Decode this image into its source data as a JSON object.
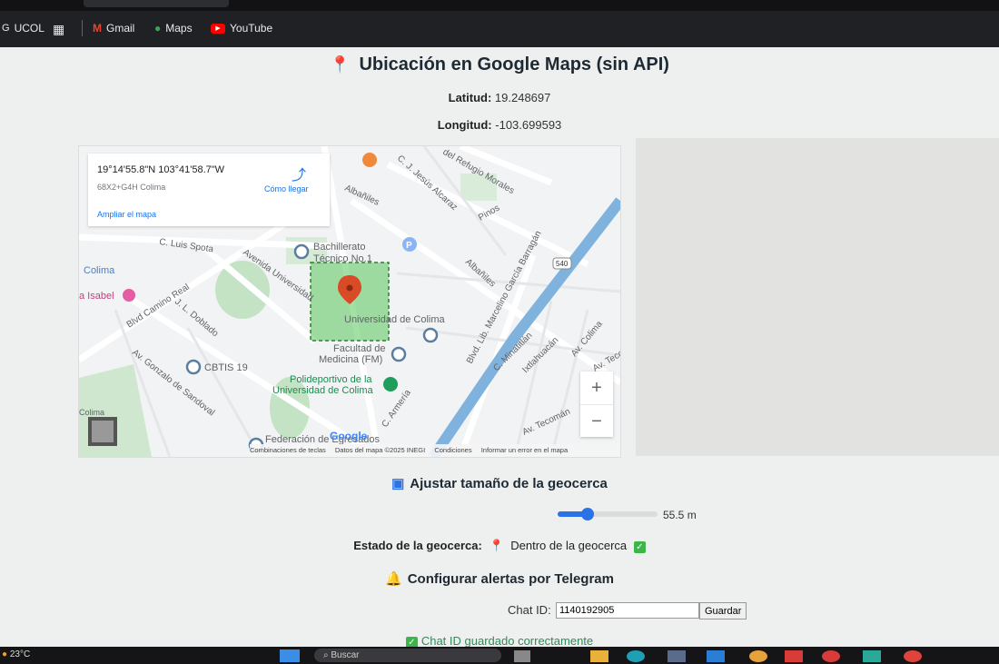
{
  "bookmarks": {
    "items": [
      {
        "label": "UCOL"
      },
      {
        "label": "Gmail"
      },
      {
        "label": "Maps"
      },
      {
        "label": "YouTube"
      }
    ]
  },
  "page": {
    "title": "Ubicación en Google Maps (sin API)",
    "lat_label": "Latitud:",
    "lat_value": "19.248697",
    "lng_label": "Longitud:",
    "lng_value": "-103.699593"
  },
  "map": {
    "card_coords": "19°14'55.8\"N 103°41'58.7\"W",
    "card_pluscode": "68X2+G4H Colima",
    "card_directions": "Cómo llegar",
    "card_enlarge": "Ampliar el mapa",
    "labels": {
      "refugio": "del Refugio Morales",
      "jesus": "C. J. Jesús Alcaraz",
      "albaniles": "Albañiles",
      "albaniles2": "Albañiles",
      "pinos": "Pinos",
      "luis": "C. Luis Spota",
      "colima": "Colima",
      "isabel": "a Isabel",
      "bachillerato1": "Bachillerato",
      "bachillerato2": "Técnico No.1",
      "avenida": "Avenida Universidad",
      "camino": "Blvd Camino Real",
      "doblado": "J. L. Doblado",
      "gonzalo": "Av. Gonzalo de Sandoval",
      "cbtis": "CBTIS 19",
      "universidad": "Universidad de Colima",
      "facultad1": "Facultad de",
      "facultad2": "Medicina (FM)",
      "poli1": "Polideportivo de la",
      "poli2": "Universidad de Colima",
      "marcelino": "Blvd. Lib. Marcelino García Barragán",
      "hwy": "540",
      "minatitlan": "C. Minatitlán",
      "ixtlahuacan": "Ixtlahuacán",
      "avcolima": "Av. Colima",
      "tecoman": "Av. Tecomán",
      "tecom2": "Av. Tecom",
      "armeria": "C. Armería",
      "federacion": "Federación de Egresados",
      "colima_small": "Colima",
      "parking": "P"
    },
    "zoom_in": "+",
    "zoom_out": "−",
    "google": "Google",
    "footer": {
      "keys": "Combinaciones de teclas",
      "data": "Datos del mapa ©2025 INEGI",
      "terms": "Condiciones",
      "report": "Informar un error en el mapa"
    },
    "colors": {
      "geofence": "#48c24a",
      "pin": "#d94a26",
      "highway": "#7fb2dd"
    }
  },
  "geofence": {
    "heading": "Ajustar tamaño de la geocerca",
    "slider_fraction": 0.3,
    "value_text": "55.5 m",
    "status_label": "Estado de la geocerca:",
    "status_value": "Dentro de la geocerca"
  },
  "telegram": {
    "heading": "Configurar alertas por Telegram",
    "chat_label": "Chat ID:",
    "chat_value": "1140192905",
    "save_label": "Guardar",
    "saved_msg": "Chat ID guardado correctamente"
  },
  "taskbar": {
    "temperature": "23°C",
    "search_placeholder": "Buscar"
  }
}
